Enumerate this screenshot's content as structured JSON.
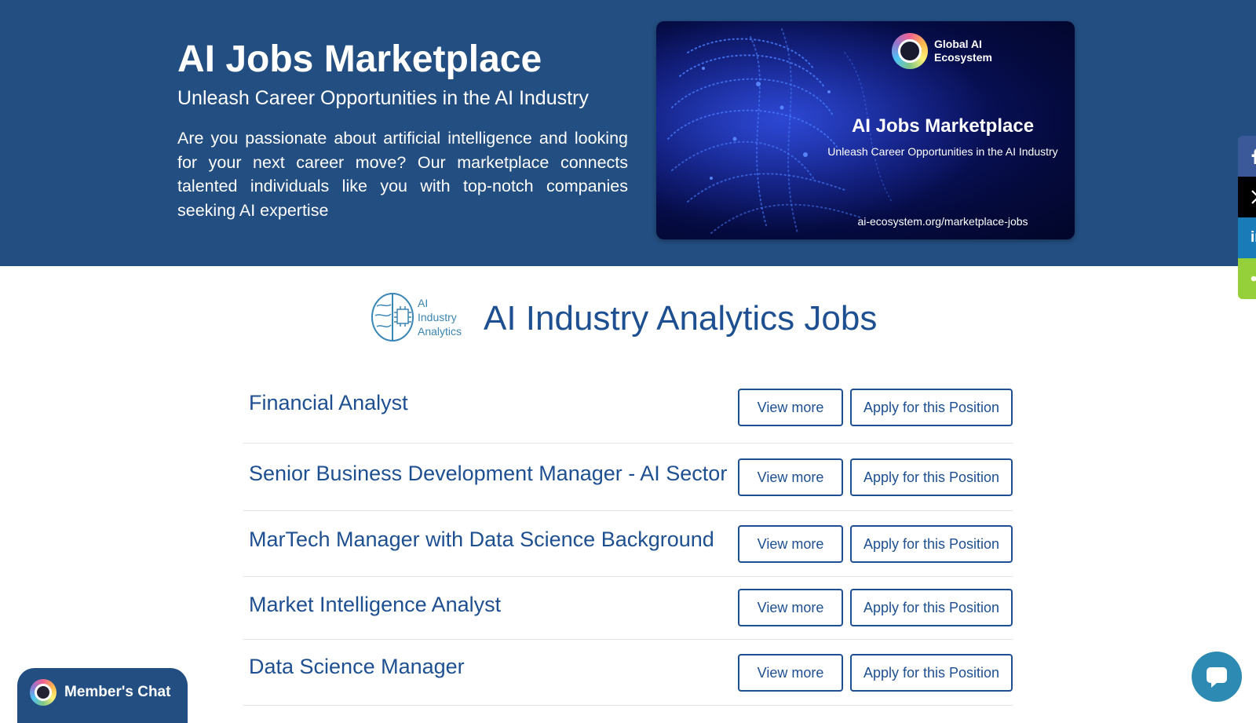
{
  "hero": {
    "title": "AI Jobs Marketplace",
    "subtitle": "Unleash Career Opportunities in the AI Industry",
    "description": "Are you passionate about artificial intelligence and looking for your next career move?  Our marketplace connects talented individuals like you with top-notch companies seeking AI expertise"
  },
  "banner": {
    "logo_text_line1": "Global AI",
    "logo_text_line2": "Ecosystem",
    "title": "AI Jobs Marketplace",
    "subtitle": "Unleash Career Opportunities in the AI Industry",
    "url": "ai-ecosystem.org/marketplace-jobs"
  },
  "share": {
    "items": [
      "facebook-icon",
      "x-icon",
      "linkedin-icon",
      "share-icon"
    ],
    "linkedin_label": "in"
  },
  "section": {
    "logo_line1": "AI",
    "logo_line2": "Industry",
    "logo_line3": "Analytics",
    "title": "AI Industry Analytics Jobs"
  },
  "jobs": [
    {
      "title": "Financial Analyst",
      "view_label": "View more",
      "apply_label": "Apply for this Position"
    },
    {
      "title": "Senior Business Development Manager - AI Sector",
      "view_label": "View more",
      "apply_label": "Apply for this Position"
    },
    {
      "title": "MarTech Manager with Data Science Background",
      "view_label": "View more",
      "apply_label": "Apply for this Position"
    },
    {
      "title": "Market Intelligence Analyst",
      "view_label": "View more",
      "apply_label": "Apply for this Position"
    },
    {
      "title": "Data Science Manager",
      "view_label": "View more",
      "apply_label": "Apply for this Position"
    }
  ],
  "chat": {
    "label": "Member's Chat"
  },
  "colors": {
    "hero_bg": "#234e81",
    "accent_blue": "#1d4f91",
    "facebook": "#3b5998",
    "x": "#000000",
    "linkedin": "#1a7bb9",
    "share": "#95d03a",
    "chat_bubble": "#2d8bb3"
  }
}
